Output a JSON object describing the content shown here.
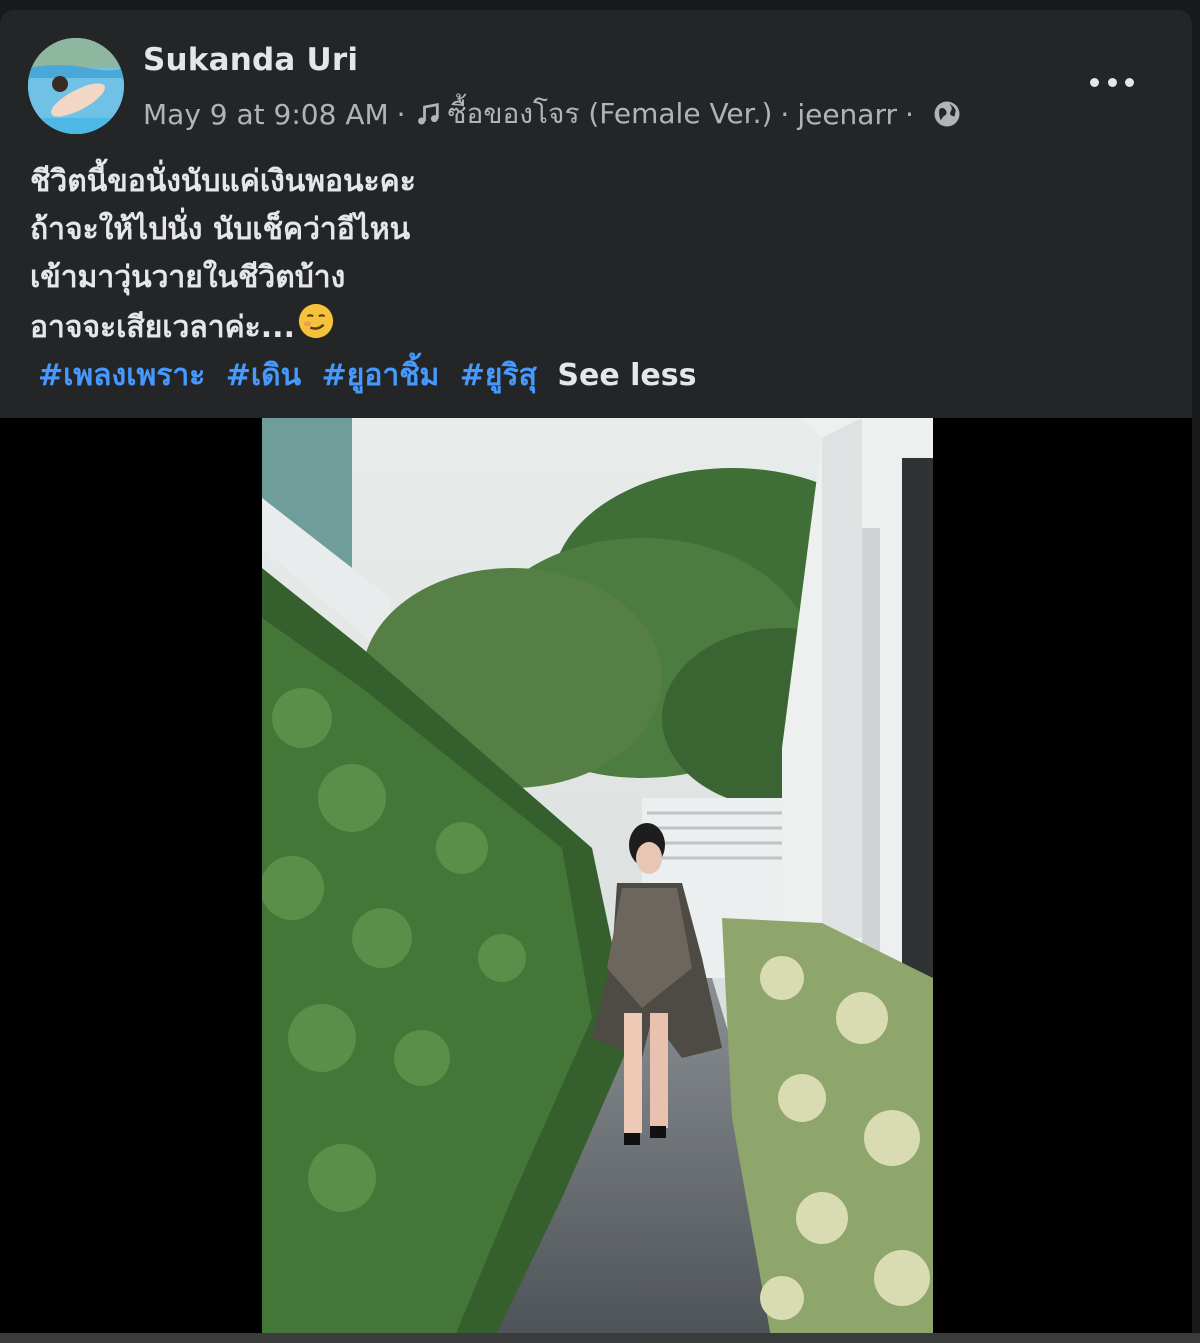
{
  "post": {
    "author": "Sukanda Uri",
    "timestamp": "May 9 at 9:08 AM",
    "separator": "·",
    "song": "ซื้อของโจร (Female Ver.)",
    "artist": "jeenarr",
    "audience_icon": "globe-icon",
    "music_icon": "music-note-icon",
    "more_icon": "more-options-icon",
    "text_lines": [
      "ชีวิตนี้ขอนั่งนับแค่เงินพอนะคะ",
      "ถ้าจะให้ไปนั่ง นับเช็คว่าอีไหน",
      "เข้ามาวุ่นวายในชีวิตบ้าง",
      "อาจจะเสียเวลาค่ะ..."
    ],
    "emoji": "smirk-emoji",
    "hashtags": [
      "#เพลงเพราะ",
      "#เดิน",
      "#ยูอาชิ้ม",
      "#ยูริสุ"
    ],
    "see_less": "See less"
  },
  "colors": {
    "background": "#18191a",
    "card": "#242526",
    "primary_text": "#e4e6eb",
    "secondary_text": "#b0b3b8",
    "hashtag": "#4599ff"
  }
}
